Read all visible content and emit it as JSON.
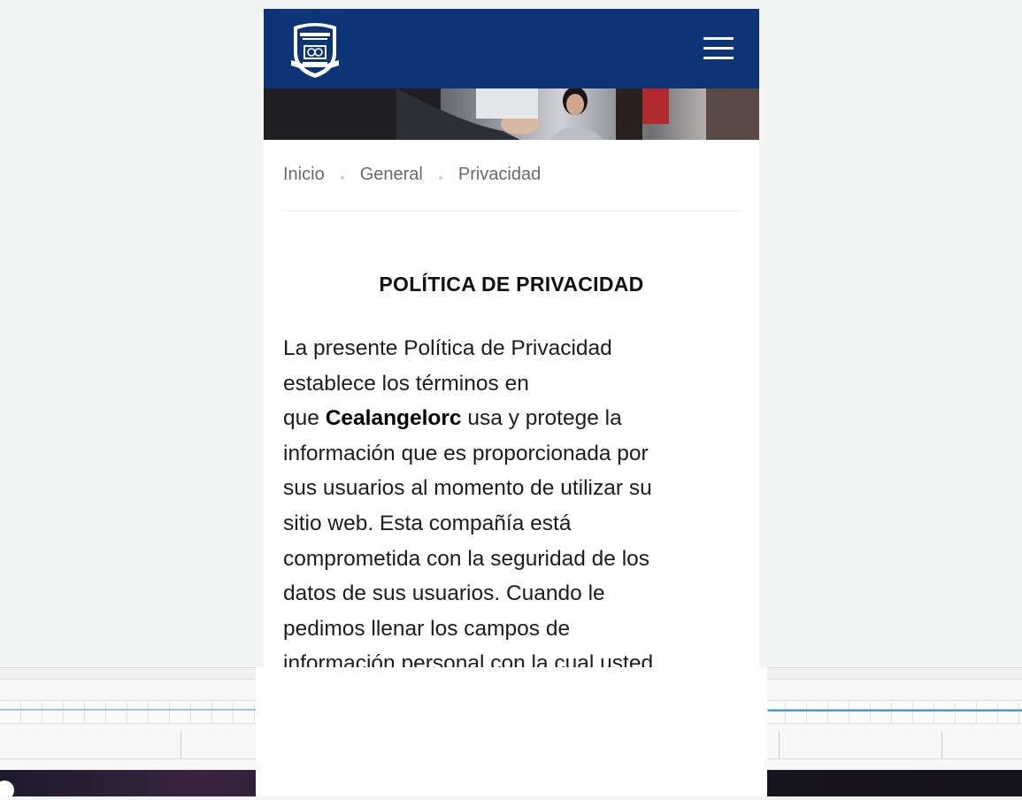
{
  "header": {
    "logo_name": "school-crest-logo",
    "menu_icon": "hamburger-menu-icon"
  },
  "breadcrumb": [
    "Inicio",
    "General",
    "Privacidad"
  ],
  "page": {
    "title": "POLÍTICA DE PRIVACIDAD",
    "intro_lines": [
      "La presente Política de Privacidad",
      "establece los términos en"
    ],
    "line3_prefix": "que ",
    "company_name": "Cealangelorc",
    "line3_suffix": " usa y protege la",
    "rest_lines": [
      "información que es proporcionada por",
      "sus usuarios al momento de utilizar su",
      "sitio web. Esta compañía está",
      "comprometida con la seguridad de los",
      "datos de sus usuarios. Cuando le",
      "pedimos llenar los campos de",
      "información personal con la cual usted"
    ]
  },
  "colors": {
    "header_bg": "#0c3477",
    "text": "#1d1d1d",
    "breadcrumb": "#6a6a6a"
  }
}
